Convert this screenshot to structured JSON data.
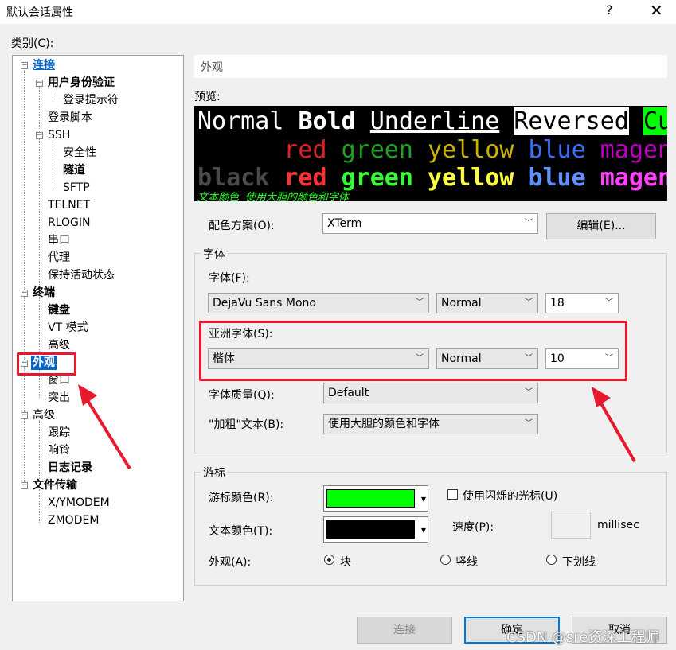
{
  "window": {
    "title": "默认会话属性",
    "help": "?",
    "close": "✕"
  },
  "category_label": "类别(C):",
  "tree": {
    "connect": "连接",
    "user_auth": "用户身份验证",
    "login_prompt": "登录提示符",
    "login_script": "登录脚本",
    "ssh": "SSH",
    "security": "安全性",
    "tunnel": "隧道",
    "sftp": "SFTP",
    "telnet": "TELNET",
    "rlogin": "RLOGIN",
    "serial": "串口",
    "proxy": "代理",
    "keepalive": "保持活动状态",
    "terminal": "终端",
    "keyboard": "键盘",
    "vt_mode": "VT 模式",
    "advanced_term": "高级",
    "appearance": "外观",
    "window": "窗口",
    "highlight": "突出",
    "advanced": "高级",
    "trace": "跟踪",
    "bell": "响铃",
    "logging": "日志记录",
    "file_transfer": "文件传输",
    "xymodem": "X/YMODEM",
    "zmodem": "ZMODEM"
  },
  "section_title": "外观",
  "preview": {
    "label": "预览:",
    "line1": [
      "Normal",
      "Bold",
      "Underline",
      "Reversed",
      "Cu"
    ],
    "line2": [
      "red",
      "green",
      "yellow",
      "blue",
      "magen"
    ],
    "line3": [
      "black",
      "red",
      "green",
      "yellow",
      "blue",
      "magen"
    ],
    "line4": "文本颜色 使用大胆的颜色和字体",
    "colors": {
      "red": "#e02020",
      "green": "#1fa31f",
      "yellow": "#c8b400",
      "blue": "#3a6eff",
      "magenta": "#c000c0",
      "bred": "#ff3030",
      "bgreen": "#33ff33",
      "byellow": "#ffff40",
      "bblue": "#6090ff",
      "bmagenta": "#ff40ff",
      "black": "#4a4a4a"
    }
  },
  "color_scheme": {
    "label": "配色方案(O):",
    "value": "XTerm",
    "edit_button": "编辑(E)..."
  },
  "font": {
    "group_label": "字体",
    "font_label": "字体(F):",
    "font_value": "DejaVu Sans Mono",
    "font_style": "Normal",
    "font_size": "18",
    "asian_label": "亚洲字体(S):",
    "asian_value": "楷体",
    "asian_style": "Normal",
    "asian_size": "10",
    "quality_label": "字体质量(Q):",
    "quality_value": "Default",
    "bold_label": "\"加粗\"文本(B):",
    "bold_value": "使用大胆的颜色和字体"
  },
  "cursor": {
    "group_label": "游标",
    "cursor_color_label": "游标颜色(R):",
    "cursor_color": "#00ff00",
    "text_color_label": "文本颜色(T):",
    "text_color": "#000000",
    "blink_label": "使用闪烁的光标(U)",
    "speed_label": "速度(P):",
    "speed_value": "",
    "speed_unit": "millisec",
    "shape_label": "外观(A):",
    "shape_block": "块",
    "shape_vline": "竖线",
    "shape_underline": "下划线"
  },
  "buttons": {
    "connect": "连接",
    "ok": "确定",
    "cancel": "取消"
  },
  "watermark": "CSDN @sre资深工程师"
}
